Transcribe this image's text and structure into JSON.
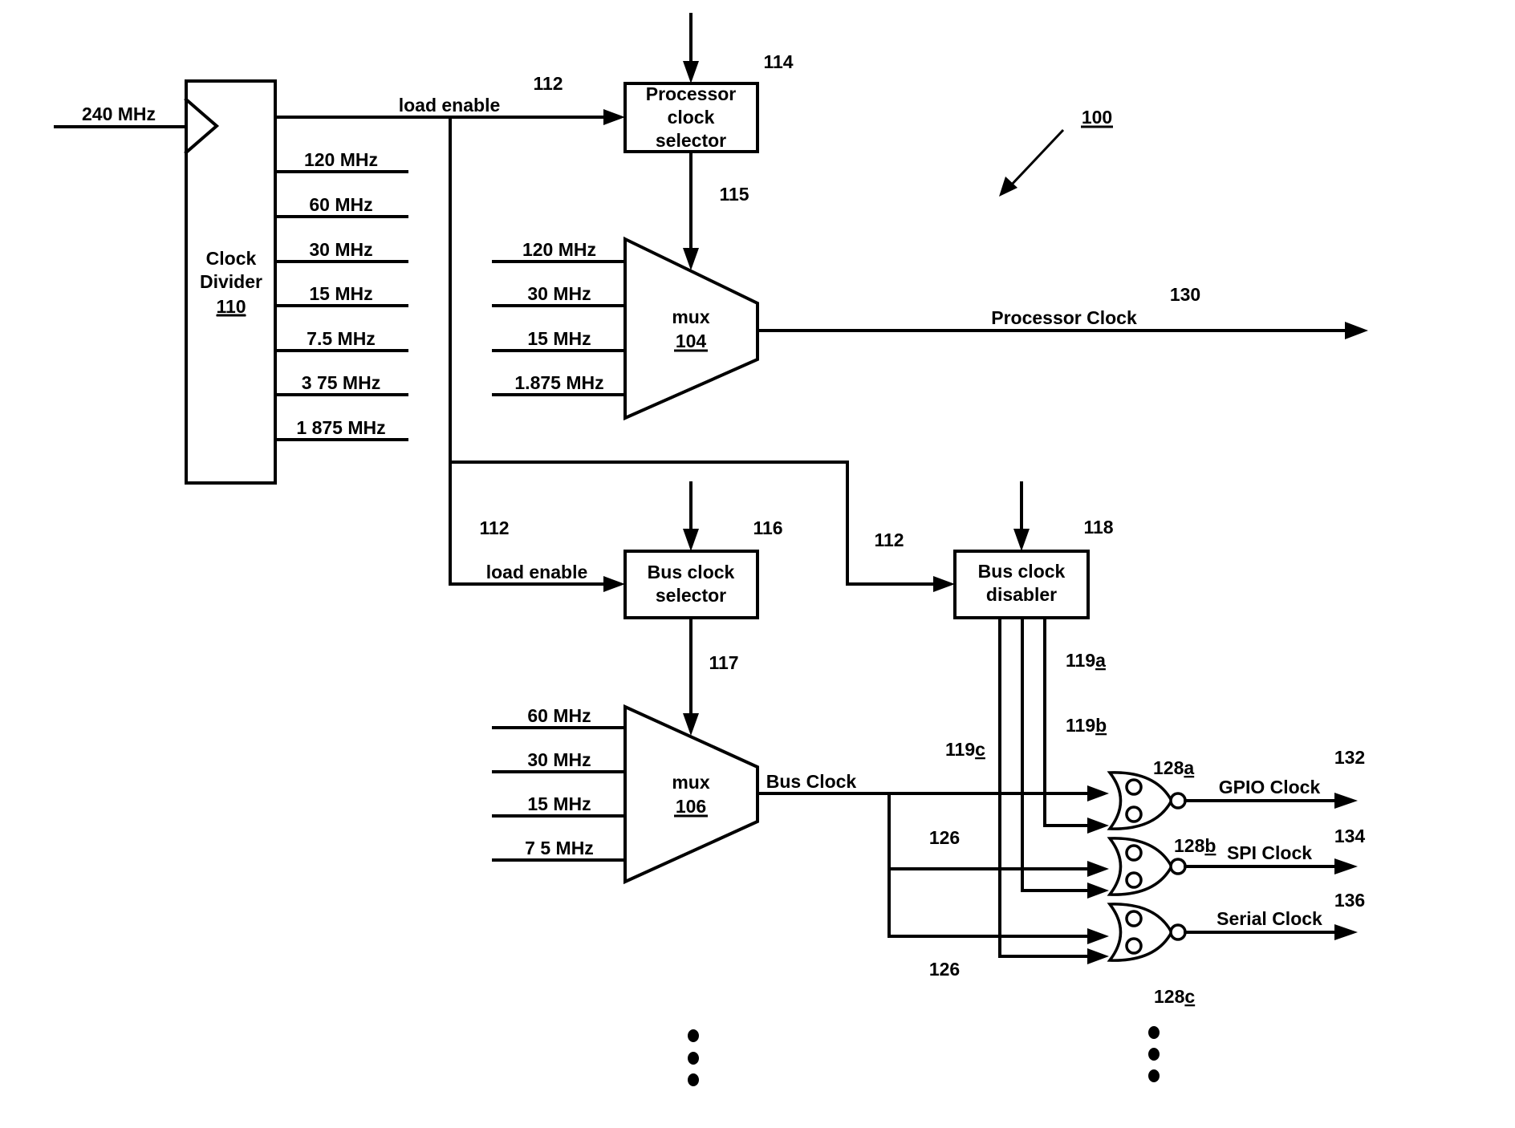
{
  "figure": {
    "reference": "100",
    "input_clock": "240 MHz"
  },
  "clock_divider": {
    "title_line1": "Clock",
    "title_line2": "Divider",
    "ref": "110",
    "load_enable_label": "load enable",
    "outputs": [
      "120 MHz",
      "60 MHz",
      "30 MHz",
      "15 MHz",
      "7.5 MHz",
      "3 75 MHz",
      "1 875 MHz"
    ]
  },
  "signals": {
    "load_enable_ref_top": "112",
    "load_enable_ref_bus": "112",
    "load_enable_ref_disabler": "112",
    "bus_load_enable_label": "load enable",
    "select_115": "115",
    "select_117": "117"
  },
  "processor_clock_selector": {
    "line1": "Processor",
    "line2": "clock",
    "line3": "selector",
    "ref": "114"
  },
  "mux_104": {
    "title": "mux",
    "ref": "104",
    "inputs": [
      "120 MHz",
      "30 MHz",
      "15 MHz",
      "1.875 MHz"
    ],
    "output_label": "Processor Clock",
    "output_ref": "130"
  },
  "bus_clock_selector": {
    "line1": "Bus clock",
    "line2": "selector",
    "ref": "116"
  },
  "mux_106": {
    "title": "mux",
    "ref": "106",
    "inputs": [
      "60 MHz",
      "30 MHz",
      "15 MHz",
      "7 5 MHz"
    ],
    "output_label": "Bus Clock",
    "branch_ref_1": "126",
    "branch_ref_2": "126"
  },
  "bus_clock_disabler": {
    "line1": "Bus clock",
    "line2": "disabler",
    "ref": "118",
    "enable_a": "119",
    "enable_a_suffix": "a",
    "enable_b": "119",
    "enable_b_suffix": "b",
    "enable_c": "119",
    "enable_c_suffix": "c"
  },
  "gates": [
    {
      "ref": "128",
      "suffix": "a",
      "output_label": "GPIO Clock",
      "output_ref": "132"
    },
    {
      "ref": "128",
      "suffix": "b",
      "output_label": "SPI Clock",
      "output_ref": "134"
    },
    {
      "ref": "128",
      "suffix": "c",
      "output_label": "Serial Clock",
      "output_ref": "136"
    }
  ],
  "continuation": {
    "left_icon": "vertical-ellipsis",
    "right_icon": "vertical-ellipsis"
  }
}
